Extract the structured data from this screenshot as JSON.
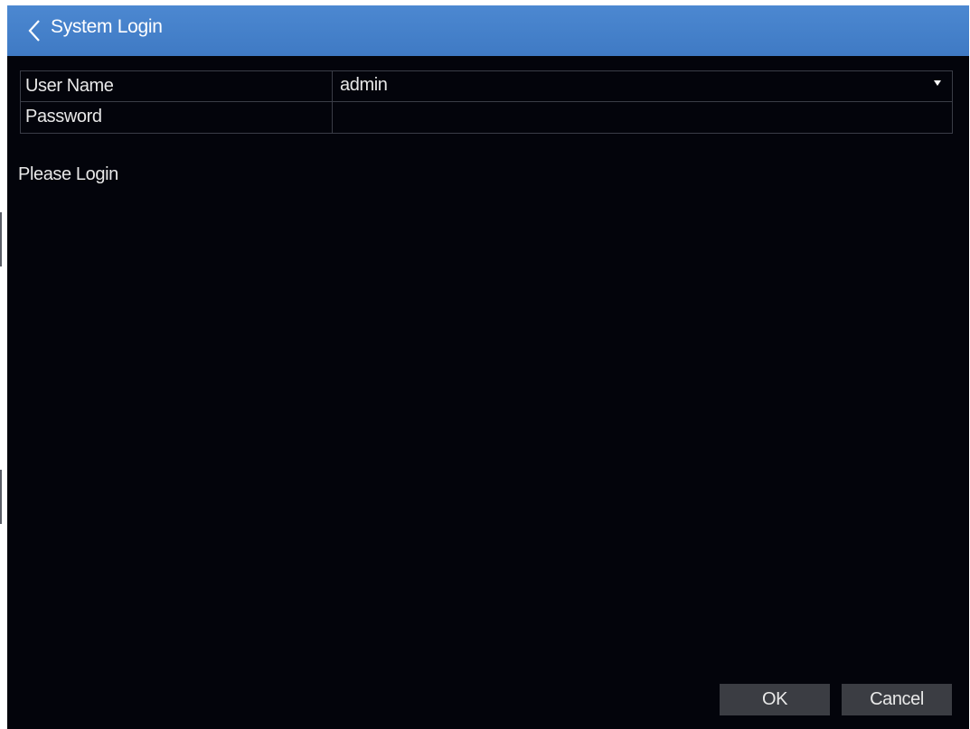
{
  "window": {
    "title": "System Login",
    "back_icon": "chevron-left-icon"
  },
  "form": {
    "username": {
      "label": "User Name",
      "value": "admin",
      "dropdown_icon": "caret-down-icon"
    },
    "password": {
      "label": "Password",
      "value": ""
    }
  },
  "status": {
    "message": "Please Login"
  },
  "buttons": {
    "ok_label": "OK",
    "cancel_label": "Cancel"
  },
  "colors": {
    "titlebar": "#4582cb",
    "background": "#03040b",
    "button": "#3b3d43",
    "border": "#3a3d47",
    "text": "#e8e8e8"
  }
}
